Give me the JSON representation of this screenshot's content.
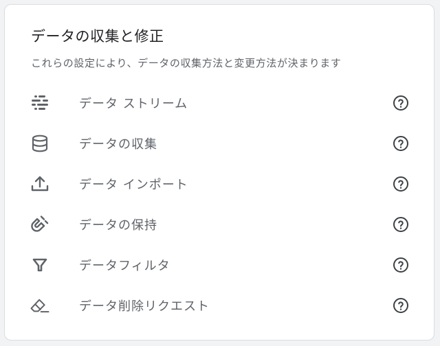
{
  "card": {
    "title": "データの収集と修正",
    "subtitle": "これらの設定により、データの収集方法と変更方法が決まります"
  },
  "items": [
    {
      "label": "データ ストリーム",
      "icon": "data-streams-icon"
    },
    {
      "label": "データの収集",
      "icon": "database-icon"
    },
    {
      "label": "データ インポート",
      "icon": "upload-icon"
    },
    {
      "label": "データの保持",
      "icon": "magnet-icon"
    },
    {
      "label": "データフィルタ",
      "icon": "filter-icon"
    },
    {
      "label": "データ削除リクエスト",
      "icon": "eraser-icon"
    }
  ],
  "help_icon": "help-circle-icon",
  "colors": {
    "background": "#f1f3f4",
    "card": "#ffffff",
    "border": "#dadce0",
    "icon": "#5f6368",
    "text": "#5f6368",
    "title": "#202124"
  }
}
